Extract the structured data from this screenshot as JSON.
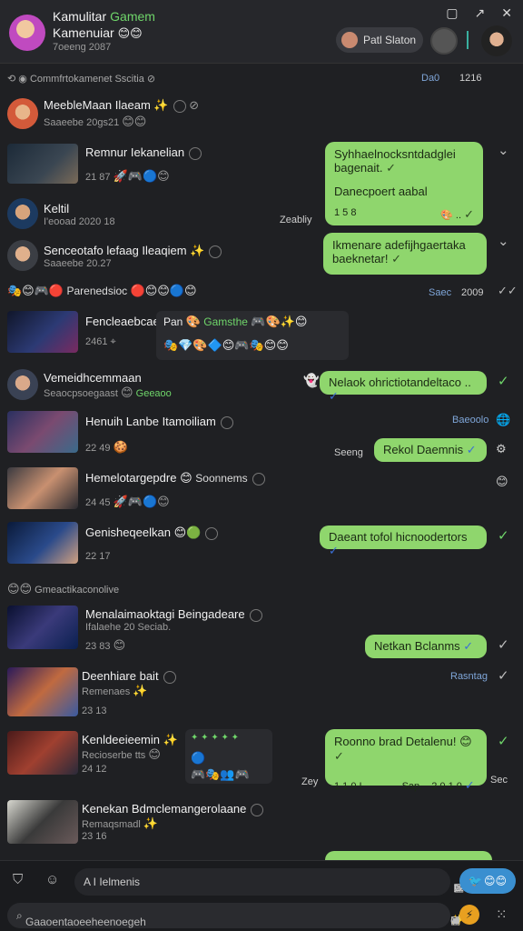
{
  "header": {
    "title": "Kamulitar",
    "title_accent": "Gamem",
    "subtitle": "Kamenuiar",
    "meta": "7oeeng 2087",
    "chip_label": "Patl Slaton"
  },
  "section1": {
    "label": "Commfrtokamenet Sscitia",
    "right1": "Da0",
    "right2": "1216"
  },
  "rows": [
    {
      "name": "MeebleMaan Ilaeam",
      "sub": "Saaeebe 20gs21"
    },
    {
      "name": "Remnur Iekanelian",
      "sub": "21 87",
      "bubble1": "Syhhaelnocksntdadglei bagenait.",
      "bubble2": "Danecpoert aabal",
      "time": "1 5 8",
      "side": "Zeabliy"
    },
    {
      "name": "Keltil",
      "sub": "I'eooad 2020 18"
    },
    {
      "name": "Senceotafo lefaag Ileaqiem",
      "sub": "Saaeebe 20.27",
      "bubble": "Ikmenare adefijhgaertaka baeknetar!"
    },
    {
      "name": "Parenedsioc",
      "side": "Saec",
      "side2": "2009"
    },
    {
      "name": "Fencleaebcae",
      "sub": "2461",
      "panel_label": "Pan",
      "panel_accent": "Gamsthe"
    },
    {
      "name": "Vemeidhcemmaan",
      "sub": "Seaocpsoegaast",
      "sub_accent": "Geeaoo",
      "bubble": "Nelaok ohrictiotandeltaco .."
    },
    {
      "name": "Henuih Lanbe Itamoiliam",
      "sub": "22 49",
      "side": "Seeng",
      "side_right": "Baeoolo",
      "bubble": "Rekol Daemnis"
    },
    {
      "name": "Hemelotargepdre",
      "sub_accent": "Soonnems",
      "sub": "24 45"
    },
    {
      "name": "Genisheqeelkan",
      "sub": "22 17",
      "bubble": "Daeant tofol hicnoodertors"
    },
    {
      "name": "Gmeactikaconolive"
    },
    {
      "name": "Menalaimaoktagi Beingadeare",
      "sub": "Ifalaehe 20 Seciab.",
      "sub2": "23 83",
      "bubble": "Netkan Bclanms"
    },
    {
      "name": "Deenhiare bait",
      "sub": "Remenaes",
      "sub2": "23 13",
      "side": "Rasntag"
    },
    {
      "name": "Kenldeeieemin",
      "sub": "Recioserbe tts",
      "sub2": "24 12",
      "bubble1": "Roonno brad Detalenu!",
      "time1": "1 1 0 I",
      "time2": "Sap.",
      "time3": "2 0 1 0",
      "side": "Zey",
      "side_right": "Sec"
    },
    {
      "name": "Kenekan Bdmclemangerolaane",
      "sub": "Remaqsmadl",
      "sub2": "23 16"
    }
  ],
  "footer": {
    "input_placeholder": "A I Ielmenis",
    "search_placeholder": "Gaaoentaoeeheenoegeh"
  }
}
